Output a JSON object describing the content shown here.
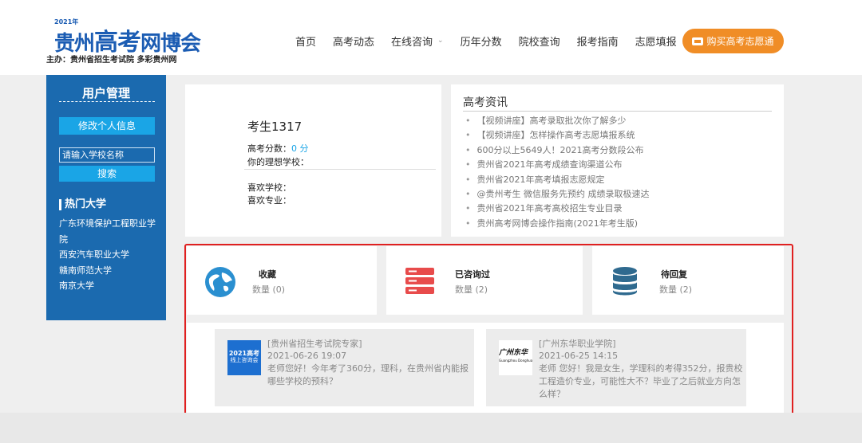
{
  "logo": {
    "year": "2021年",
    "name_a": "贵州",
    "name_b": "高考",
    "name_c": "网博会",
    "host": "主办：贵州省招生考试院 多彩贵州网"
  },
  "nav": {
    "items": [
      {
        "label": "首页",
        "has_caret": false
      },
      {
        "label": "高考动态",
        "has_caret": false
      },
      {
        "label": "在线咨询",
        "has_caret": true
      },
      {
        "label": "历年分数",
        "has_caret": false
      },
      {
        "label": "院校查询",
        "has_caret": false
      },
      {
        "label": "报考指南",
        "has_caret": false
      },
      {
        "label": "志愿填报",
        "has_caret": true
      }
    ],
    "buy_label": "购买高考志愿通"
  },
  "sidebar": {
    "title": "用户管理",
    "edit_label": "修改个人信息",
    "school_placeholder": "请输入学校名称",
    "search_label": "搜索",
    "hot_title": "热门大学",
    "hot_list": [
      "广东环境保护工程职业学院",
      "西安汽车职业大学",
      "赣南师范大学",
      "南京大学"
    ]
  },
  "profile": {
    "name": "考生1317",
    "score_label": "高考分数：",
    "score_value": "0 分",
    "ideal_label": "你的理想学校：",
    "like_school_label": "喜欢学校：",
    "like_major_label": "喜欢专业："
  },
  "news": {
    "title": "高考资讯",
    "items": [
      "【视频讲座】高考录取批次你了解多少",
      "【视频讲座】怎样操作高考志愿填报系统",
      "600分以上5649人！2021高考分数段公布",
      "贵州省2021年高考成绩查询渠道公布",
      "贵州省2021年高考填报志愿规定",
      "@贵州考生 微信服务先预约 成绩录取极速达",
      "贵州省2021年高考高校招生专业目录",
      "贵州高考网博会操作指南(2021年考生版)"
    ]
  },
  "stats": [
    {
      "label": "收藏",
      "count": "数量 (0)",
      "icon": "globe-icon",
      "color": "#2a8fd0"
    },
    {
      "label": "已咨询过",
      "count": "数量 (2)",
      "icon": "server-icon",
      "color": "#e84b4b"
    },
    {
      "label": "待回复",
      "count": "数量 (2)",
      "icon": "database-icon",
      "color": "#2f6a8f"
    }
  ],
  "qa": [
    {
      "source": "[贵州省招生考试院专家]",
      "time": "2021-06-26 19:07",
      "text_1": "老师您好！今年考了360分，理科，在贵州省内能报",
      "text_2": "哪些学校的预科？",
      "thumb_text_1": "2021高考",
      "thumb_text_2": "线上咨询会"
    },
    {
      "source": "[广州东华职业学院]",
      "time": "2021-06-25 14:15",
      "text_1": "老师 您好！我是女生，学理科的考得352分，报贵校",
      "text_2": "工程造价专业，可能性大不？毕业了之后就业方向怎",
      "text_3": "么样？",
      "thumb_text_1": "广州东华",
      "thumb_text_2": "Guangzhou Donghua V"
    }
  ]
}
